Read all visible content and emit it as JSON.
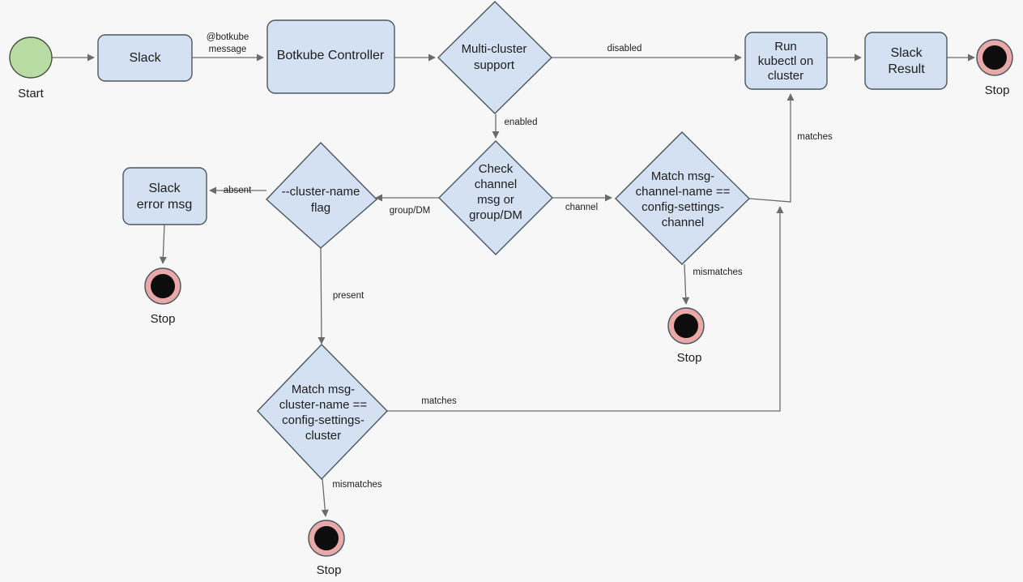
{
  "diagram": {
    "title": "Botkube multi-cluster Slack command routing flowchart",
    "background_color": "#f7f7f7",
    "palette": {
      "process_fill": "#d4e1f2",
      "decision_fill": "#d4e1f2",
      "start_fill": "#b9dca4",
      "stop_ring_fill": "#eaa8a8",
      "stop_core_fill": "#0d0d0d",
      "edge_color": "#6b6b6b",
      "stroke_color": "#49585f",
      "text_color": "#1d1d1d"
    }
  },
  "nodes": {
    "start": {
      "shape": "circle",
      "outside_label": "Start"
    },
    "slack": {
      "shape": "rounded-rect",
      "lines": [
        "Slack"
      ]
    },
    "botkube_controller": {
      "shape": "rounded-rect",
      "lines": [
        "Botkube Controller"
      ]
    },
    "multi_cluster_support": {
      "shape": "diamond",
      "lines": [
        "Multi-cluster",
        "support"
      ]
    },
    "run_kubectl": {
      "shape": "rounded-rect",
      "lines": [
        "Run",
        "kubectl on",
        "cluster"
      ]
    },
    "slack_result": {
      "shape": "rounded-rect",
      "lines": [
        "Slack",
        "Result"
      ]
    },
    "stop_top_right": {
      "shape": "end-circle",
      "outside_label": "Stop"
    },
    "check_channel": {
      "shape": "diamond",
      "lines": [
        "Check",
        "channel",
        "msg or",
        "group/DM"
      ]
    },
    "cluster_name_flag": {
      "shape": "diamond",
      "lines": [
        "--cluster-name",
        "flag"
      ]
    },
    "slack_error_msg": {
      "shape": "rounded-rect",
      "lines": [
        "Slack",
        "error msg"
      ]
    },
    "stop_error": {
      "shape": "end-circle",
      "outside_label": "Stop"
    },
    "match_channel_name": {
      "shape": "diamond",
      "lines": [
        "Match msg-",
        "channel-name ==",
        "config-settings-",
        "channel"
      ]
    },
    "stop_channel_mismatch": {
      "shape": "end-circle",
      "outside_label": "Stop"
    },
    "match_cluster_name": {
      "shape": "diamond",
      "lines": [
        "Match msg-",
        "cluster-name ==",
        "config-settings-",
        "cluster"
      ]
    },
    "stop_cluster_mismatch": {
      "shape": "end-circle",
      "outside_label": "Stop"
    }
  },
  "edge_labels": {
    "botkube_message": "@botkube\nmessage",
    "botkube_message_line1": "@botkube",
    "botkube_message_line2": "message",
    "disabled": "disabled",
    "enabled": "enabled",
    "group_dm": "group/DM",
    "channel": "channel",
    "absent": "absent",
    "present": "present",
    "matches_channel": "matches",
    "mismatches_channel": "mismatches",
    "matches_cluster": "matches",
    "mismatches_cluster": "mismatches"
  },
  "edges": [
    {
      "from": "start",
      "to": "slack",
      "label": ""
    },
    {
      "from": "slack",
      "to": "botkube_controller",
      "label": "@botkube message"
    },
    {
      "from": "botkube_controller",
      "to": "multi_cluster_support",
      "label": ""
    },
    {
      "from": "multi_cluster_support",
      "to": "run_kubectl",
      "label": "disabled"
    },
    {
      "from": "run_kubectl",
      "to": "slack_result",
      "label": ""
    },
    {
      "from": "slack_result",
      "to": "stop_top_right",
      "label": ""
    },
    {
      "from": "multi_cluster_support",
      "to": "check_channel",
      "label": "enabled"
    },
    {
      "from": "check_channel",
      "to": "cluster_name_flag",
      "label": "group/DM"
    },
    {
      "from": "check_channel",
      "to": "match_channel_name",
      "label": "channel"
    },
    {
      "from": "cluster_name_flag",
      "to": "slack_error_msg",
      "label": "absent"
    },
    {
      "from": "slack_error_msg",
      "to": "stop_error",
      "label": ""
    },
    {
      "from": "cluster_name_flag",
      "to": "match_cluster_name",
      "label": "present"
    },
    {
      "from": "match_channel_name",
      "to": "run_kubectl",
      "label": "matches"
    },
    {
      "from": "match_channel_name",
      "to": "stop_channel_mismatch",
      "label": "mismatches"
    },
    {
      "from": "match_cluster_name",
      "to": "run_kubectl",
      "label": "matches"
    },
    {
      "from": "match_cluster_name",
      "to": "stop_cluster_mismatch",
      "label": "mismatches"
    }
  ]
}
